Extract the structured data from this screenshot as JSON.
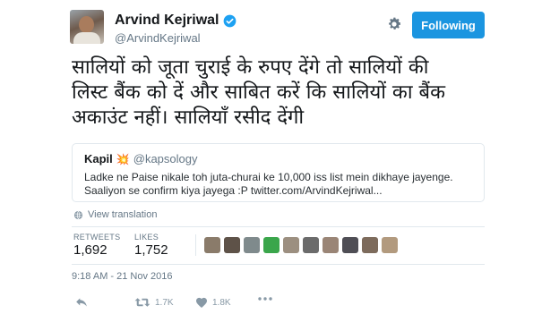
{
  "author": {
    "display_name": "Arvind Kejriwal",
    "handle": "@ArvindKejriwal",
    "verified": true
  },
  "header": {
    "follow_label": "Following",
    "settings_icon": "gear-icon"
  },
  "tweet": {
    "lines": [
      "सालियों को जूता चुराई के रुपए देंगे तो सालियों की",
      "लिस्ट बैंक को दें और साबित करें कि सालियों का बैंक",
      "अकाउंट नहीं। सालियाँ रसीद देंगी"
    ]
  },
  "quote": {
    "name": "Kapil",
    "emoji": "💥",
    "handle": "@kapsology",
    "line1": "Ladke ne Paise nikale toh juta-churai ke 10,000 iss list mein dikhaye jayenge.",
    "line2": "Saaliyon se confirm kiya jayega :P twitter.com/ArvindKejriwal..."
  },
  "translation": {
    "label": "View translation",
    "icon": "globe-icon"
  },
  "stats": {
    "retweets_label": "RETWEETS",
    "retweets_value": "1,692",
    "likes_label": "LIKES",
    "likes_value": "1,752"
  },
  "likers": [
    {
      "color": "#8a7b6a"
    },
    {
      "color": "#5e5248"
    },
    {
      "color": "#7f8a8c"
    },
    {
      "color": "#3aa64b"
    },
    {
      "color": "#9c8f80"
    },
    {
      "color": "#6b6b6b"
    },
    {
      "color": "#9a8576"
    },
    {
      "color": "#4f4e55"
    },
    {
      "color": "#7d6b5c"
    },
    {
      "color": "#b29a7e"
    }
  ],
  "timestamp": "9:18 AM - 21 Nov 2016",
  "actions": {
    "reply_icon": "reply-icon",
    "retweet_count": "1.7K",
    "like_count": "1.8K",
    "more_icon": "more-icon"
  },
  "colors": {
    "accent": "#1b95e0",
    "text": "#14171a",
    "muted": "#657786",
    "border": "#e1e8ed"
  }
}
